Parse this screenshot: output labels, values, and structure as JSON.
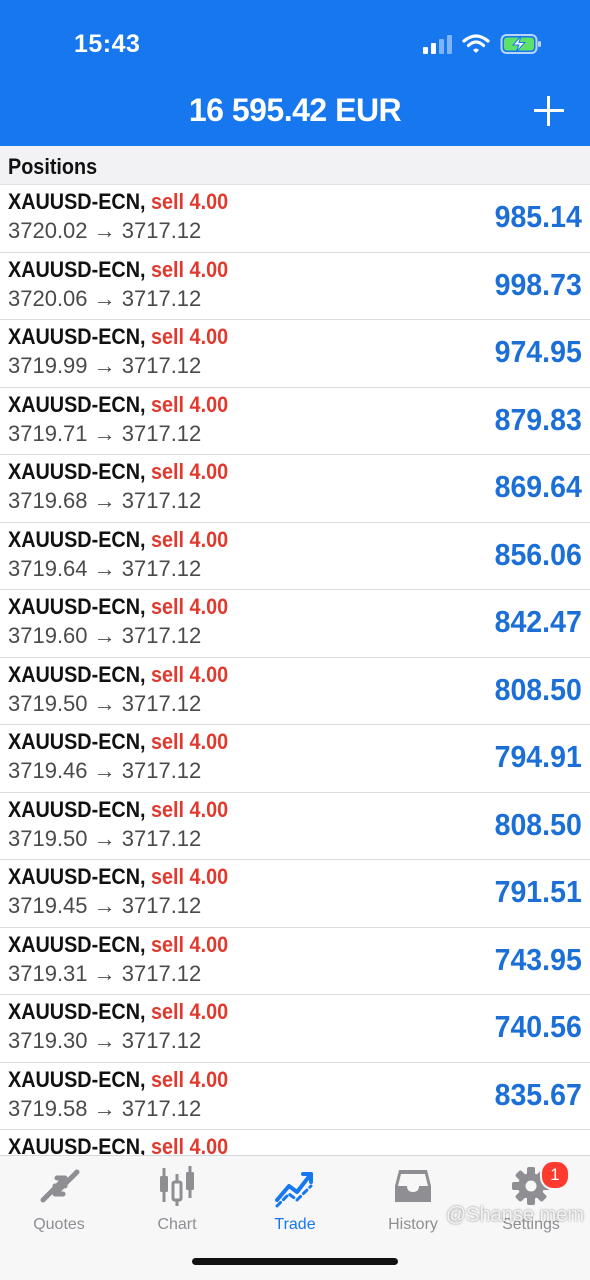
{
  "status_bar": {
    "time": "15:43",
    "icons": [
      "signal-icon",
      "wifi-icon",
      "battery-charging-icon"
    ]
  },
  "header": {
    "title": "16 595.42 EUR",
    "add_icon": "plus-icon"
  },
  "section": {
    "title": "Positions"
  },
  "positions": [
    {
      "symbol": "XAUUSD-ECN",
      "side": "sell 4.00",
      "prices": "3720.02 → 3717.12",
      "profit": "985.14"
    },
    {
      "symbol": "XAUUSD-ECN",
      "side": "sell 4.00",
      "prices": "3720.06 → 3717.12",
      "profit": "998.73"
    },
    {
      "symbol": "XAUUSD-ECN",
      "side": "sell 4.00",
      "prices": "3719.99 → 3717.12",
      "profit": "974.95"
    },
    {
      "symbol": "XAUUSD-ECN",
      "side": "sell 4.00",
      "prices": "3719.71 → 3717.12",
      "profit": "879.83"
    },
    {
      "symbol": "XAUUSD-ECN",
      "side": "sell 4.00",
      "prices": "3719.68 → 3717.12",
      "profit": "869.64"
    },
    {
      "symbol": "XAUUSD-ECN",
      "side": "sell 4.00",
      "prices": "3719.64 → 3717.12",
      "profit": "856.06"
    },
    {
      "symbol": "XAUUSD-ECN",
      "side": "sell 4.00",
      "prices": "3719.60 → 3717.12",
      "profit": "842.47"
    },
    {
      "symbol": "XAUUSD-ECN",
      "side": "sell 4.00",
      "prices": "3719.50 → 3717.12",
      "profit": "808.50"
    },
    {
      "symbol": "XAUUSD-ECN",
      "side": "sell 4.00",
      "prices": "3719.46 → 3717.12",
      "profit": "794.91"
    },
    {
      "symbol": "XAUUSD-ECN",
      "side": "sell 4.00",
      "prices": "3719.50 → 3717.12",
      "profit": "808.50"
    },
    {
      "symbol": "XAUUSD-ECN",
      "side": "sell 4.00",
      "prices": "3719.45 → 3717.12",
      "profit": "791.51"
    },
    {
      "symbol": "XAUUSD-ECN",
      "side": "sell 4.00",
      "prices": "3719.31 → 3717.12",
      "profit": "743.95"
    },
    {
      "symbol": "XAUUSD-ECN",
      "side": "sell 4.00",
      "prices": "3719.30 → 3717.12",
      "profit": "740.56"
    },
    {
      "symbol": "XAUUSD-ECN",
      "side": "sell 4.00",
      "prices": "3719.58 → 3717.12",
      "profit": "835.67"
    },
    {
      "symbol": "XAUUSD-ECN",
      "side": "sell 4.00",
      "prices": "",
      "profit": ""
    }
  ],
  "tabs": [
    {
      "label": "Quotes",
      "icon": "quotes-arrows-icon",
      "active": false
    },
    {
      "label": "Chart",
      "icon": "candlestick-chart-icon",
      "active": false
    },
    {
      "label": "Trade",
      "icon": "trade-trend-icon",
      "active": true
    },
    {
      "label": "History",
      "icon": "inbox-history-icon",
      "active": false
    },
    {
      "label": "Settings",
      "icon": "gear-icon",
      "active": false,
      "badge": "1"
    }
  ],
  "watermark": "@Shanse mem",
  "colors": {
    "header_bg": "#1677ee",
    "sell": "#e03a2f",
    "profit": "#1b6fd6",
    "tab_active": "#1677ee",
    "tab_inactive": "#8e8e93"
  }
}
